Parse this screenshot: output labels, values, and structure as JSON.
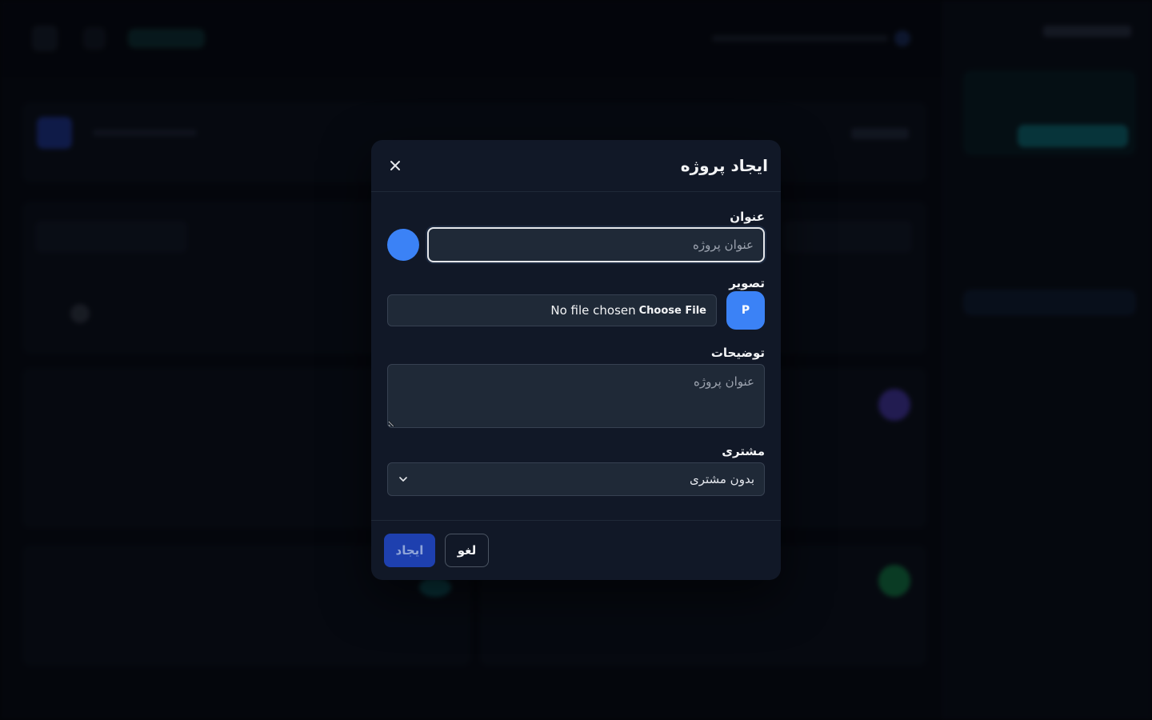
{
  "modal": {
    "title": "ایجاد پروژه",
    "close_icon": "close-icon"
  },
  "form": {
    "title_label": "عنوان",
    "title_placeholder": "عنوان پروژه",
    "title_value": "",
    "color": "#3b82f6",
    "image_label": "تصویر",
    "avatar_letter": "P",
    "file_button": "Choose File",
    "file_status": "No file chosen",
    "description_label": "توضیحات",
    "description_placeholder": "عنوان پروژه",
    "client_label": "مشتری",
    "client_selected": "بدون مشتری"
  },
  "footer": {
    "create_label": "ایجاد",
    "cancel_label": "لغو"
  },
  "colors": {
    "accent": "#3b82f6",
    "primary_button": "#1e40af",
    "modal_bg": "#111827"
  }
}
